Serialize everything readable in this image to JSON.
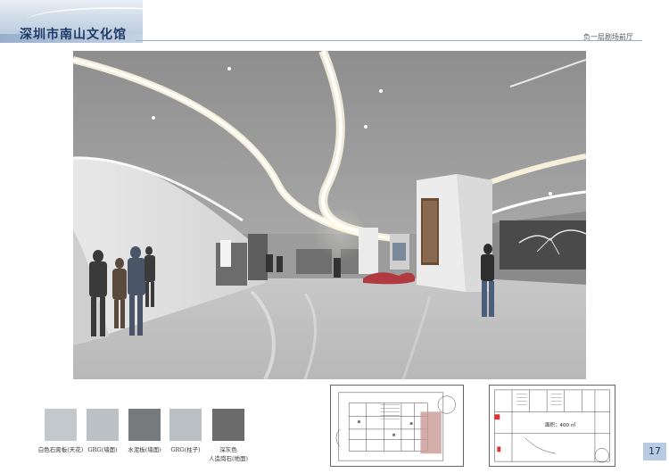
{
  "header": {
    "title": "深圳市南山文化馆",
    "subtitle": "负一层剧场前厅"
  },
  "materials": [
    {
      "label": "白色石膏板(天花)",
      "color": "#c3c8cc"
    },
    {
      "label": "GRG(墙面)",
      "color": "#bcc1c6"
    },
    {
      "label": "水泥板(墙面)",
      "color": "#777a7d"
    },
    {
      "label": "GRG(柱子)",
      "color": "#bbc0c5"
    },
    {
      "label": "深灰色",
      "label2": "人造岗石(地面)",
      "color": "#6b6b6b"
    }
  ],
  "plan": {
    "area_label": "面积：400 ㎡"
  },
  "page_number": "17"
}
